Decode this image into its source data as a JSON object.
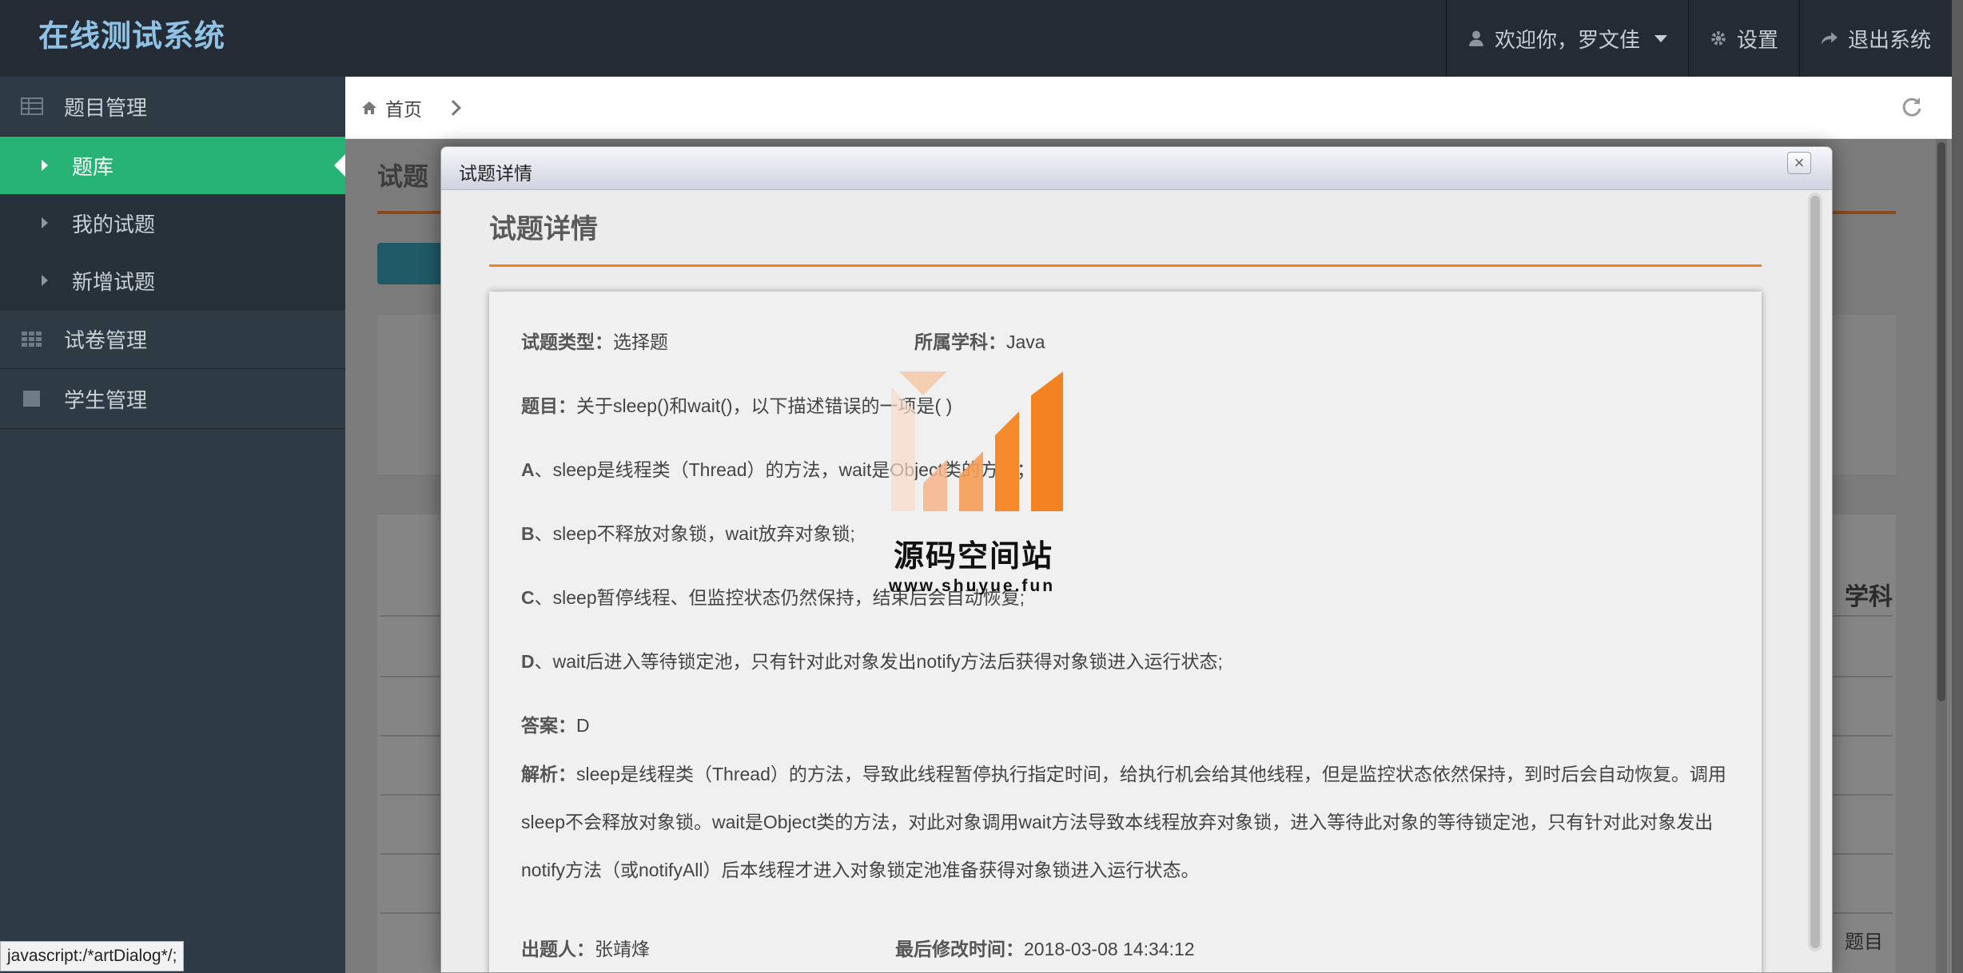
{
  "header": {
    "app_title": "在线测试系统",
    "user_greeting": "欢迎你，罗文佳",
    "settings_label": "设置",
    "logout_label": "退出系统"
  },
  "sidebar": {
    "groups": [
      {
        "label": "题目管理",
        "icon": "table-icon"
      },
      {
        "label": "试卷管理",
        "icon": "grid-icon"
      },
      {
        "label": "学生管理",
        "icon": "square-icon"
      }
    ],
    "subitems": [
      {
        "label": "题库",
        "active": true
      },
      {
        "label": "我的试题",
        "active": false
      },
      {
        "label": "新增试题",
        "active": false
      }
    ]
  },
  "breadcrumb": {
    "home_label": "首页"
  },
  "background": {
    "page_title": "试题",
    "column_label": "学科",
    "last_col_fragment": "题目"
  },
  "dialog": {
    "window_title": "试题详情",
    "heading": "试题详情",
    "type_label": "试题类型：",
    "type_value": "选择题",
    "subject_label": "所属学科：",
    "subject_value": "Java",
    "question_label": "题目：",
    "question_text": "关于sleep()和wait()，以下描述错误的一项是( )",
    "options": [
      {
        "letter": "A",
        "text": "、sleep是线程类（Thread）的方法，wait是Object类的方法；"
      },
      {
        "letter": "B",
        "text": "、sleep不释放对象锁，wait放弃对象锁;"
      },
      {
        "letter": "C",
        "text": "、sleep暂停线程、但监控状态仍然保持，结束后会自动恢复;"
      },
      {
        "letter": "D",
        "text": "、wait后进入等待锁定池，只有针对此对象发出notify方法后获得对象锁进入运行状态;"
      }
    ],
    "answer_label": "答案：",
    "answer_value": "D",
    "analysis_label": "解析：",
    "analysis_text": "sleep是线程类（Thread）的方法，导致此线程暂停执行指定时间，给执行机会给其他线程，但是监控状态依然保持，到时后会自动恢复。调用sleep不会释放对象锁。wait是Object类的方法，对此对象调用wait方法导致本线程放弃对象锁，进入等待此对象的等待锁定池，只有针对此对象发出notify方法（或notifyAll）后本线程才进入对象锁定池准备获得对象锁进入运行状态。",
    "author_label": "出题人：",
    "author_value": "张靖烽",
    "modified_label": "最后修改时间：",
    "modified_value": "2018-03-08 14:34:12"
  },
  "watermark": {
    "name": "源码空间站",
    "url": "www.shuyue.fun"
  },
  "status_bar": "javascript:/*artDialog*/;",
  "colors": {
    "header_bg": "#242b35",
    "sidebar_bg": "#2f3b44",
    "active_green": "#27b374",
    "accent_orange": "#f08020",
    "title_blue": "#8fc3e6"
  }
}
